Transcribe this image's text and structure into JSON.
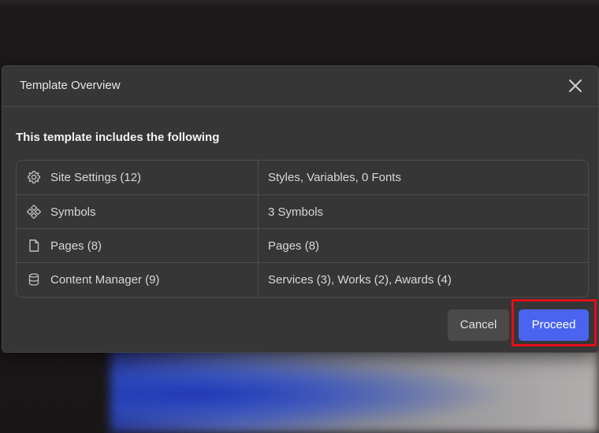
{
  "modal": {
    "title": "Template Overview",
    "intro": "This template includes the following"
  },
  "rows": [
    {
      "icon": "gear-icon",
      "label": "Site Settings (12)",
      "value": "Styles, Variables, 0 Fonts"
    },
    {
      "icon": "symbols-icon",
      "label": "Symbols",
      "value": "3 Symbols"
    },
    {
      "icon": "page-icon",
      "label": "Pages (8)",
      "value": "Pages (8)"
    },
    {
      "icon": "database-icon",
      "label": "Content Manager (9)",
      "value": "Services (3), Works (2), Awards (4)"
    }
  ],
  "actions": {
    "cancel_label": "Cancel",
    "proceed_label": "Proceed"
  },
  "colors": {
    "accent": "#4a64f0",
    "highlight": "#e0101a",
    "modal_bg": "#363636"
  }
}
